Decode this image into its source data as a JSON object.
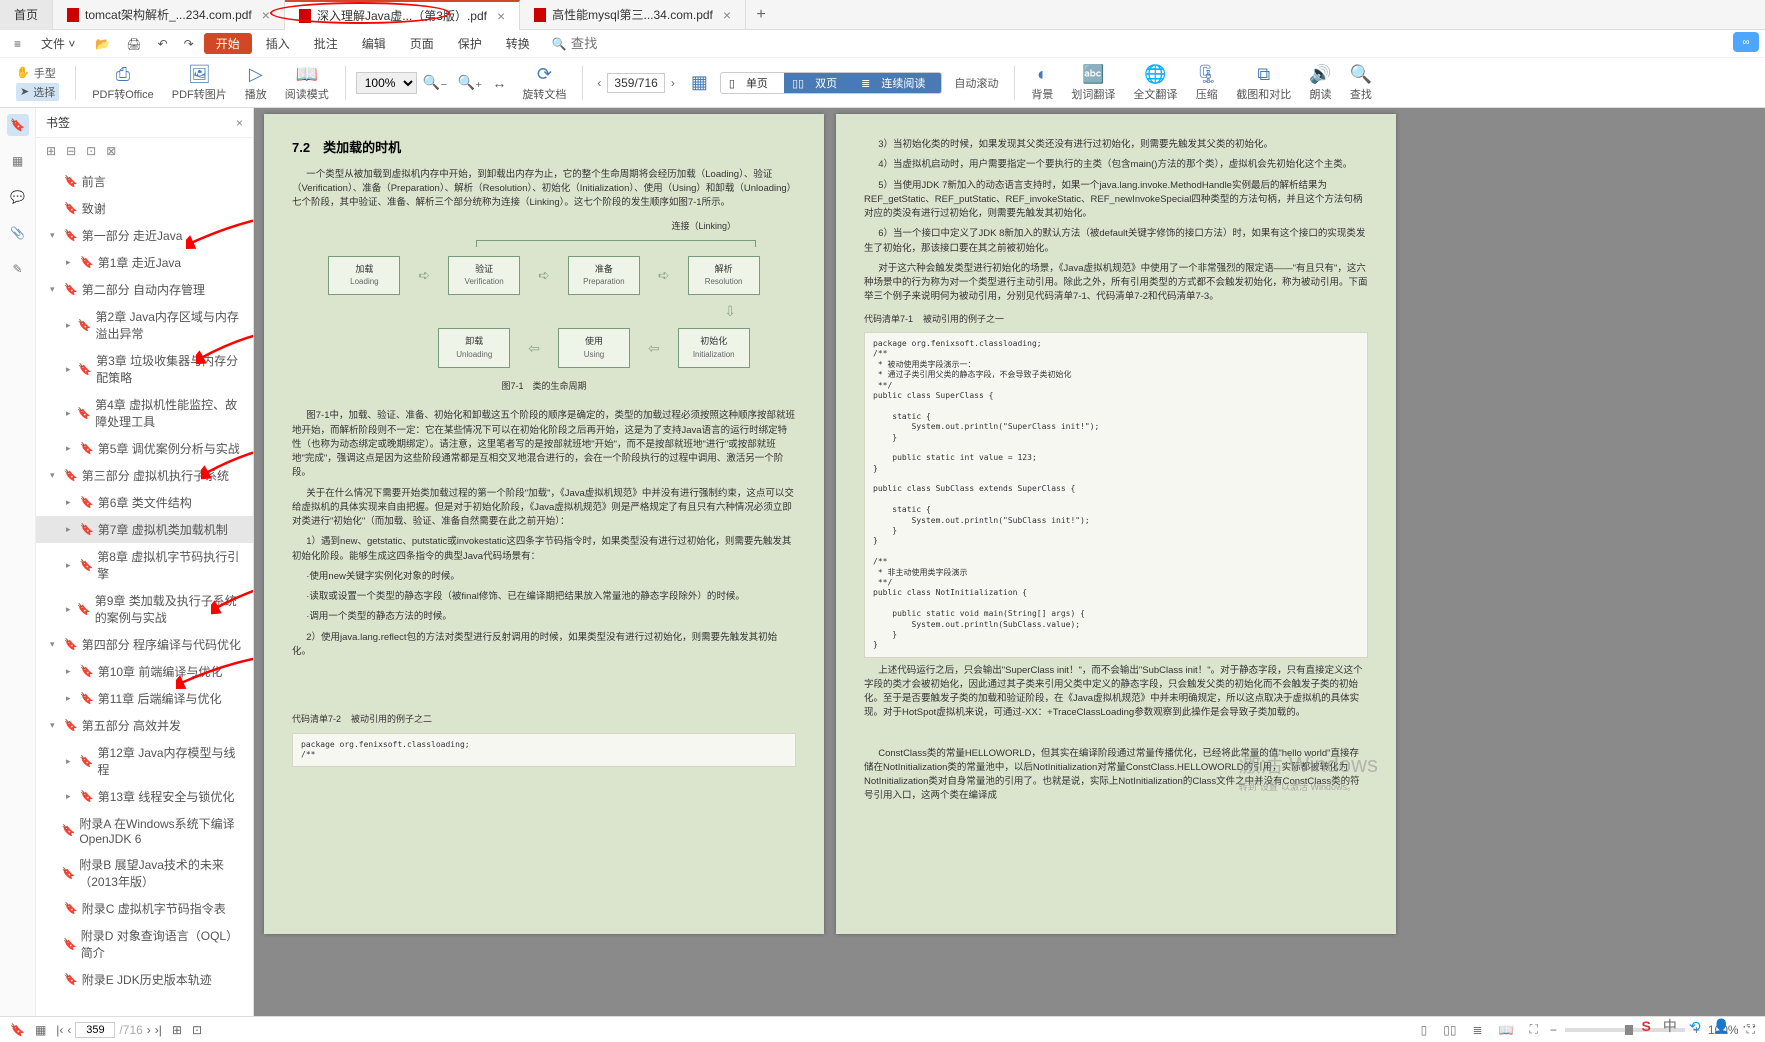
{
  "tabs": {
    "home": "首页",
    "items": [
      {
        "label": "tomcat架构解析_...234.com.pdf"
      },
      {
        "label": "深入理解Java虚...（第3版）.pdf"
      },
      {
        "label": "高性能mysql第三...34.com.pdf"
      }
    ]
  },
  "menubar": {
    "file": "文件",
    "items": [
      "开始",
      "插入",
      "批注",
      "编辑",
      "页面",
      "保护",
      "转换"
    ],
    "search_placeholder": "查找"
  },
  "ribbon": {
    "hand": "手型",
    "select": "选择",
    "pdf2office": "PDF转Office",
    "pdf2pic": "PDF转图片",
    "play": "播放",
    "readmode": "阅读模式",
    "zoom_value": "100%",
    "rotate": "旋转文档",
    "page_cur": "359",
    "page_total": "716",
    "single": "单页",
    "double": "双页",
    "continuous": "连续阅读",
    "autoscroll": "自动滚动",
    "background": "背景",
    "word_translate": "划词翻译",
    "full_translate": "全文翻译",
    "compress": "压缩",
    "crop_compare": "截图和对比",
    "read_aloud": "朗读",
    "find": "查找"
  },
  "bookmarks_title": "书签",
  "bookmarks": [
    {
      "lvl": 1,
      "tw": "",
      "label": "前言"
    },
    {
      "lvl": 1,
      "tw": "",
      "label": "致谢"
    },
    {
      "lvl": 1,
      "tw": "▾",
      "label": "第一部分 走近Java"
    },
    {
      "lvl": 2,
      "tw": "▸",
      "label": "第1章 走近Java"
    },
    {
      "lvl": 1,
      "tw": "▾",
      "label": "第二部分 自动内存管理"
    },
    {
      "lvl": 2,
      "tw": "▸",
      "label": "第2章 Java内存区域与内存溢出异常"
    },
    {
      "lvl": 2,
      "tw": "▸",
      "label": "第3章 垃圾收集器与内存分配策略"
    },
    {
      "lvl": 2,
      "tw": "▸",
      "label": "第4章 虚拟机性能监控、故障处理工具"
    },
    {
      "lvl": 2,
      "tw": "▸",
      "label": "第5章 调优案例分析与实战"
    },
    {
      "lvl": 1,
      "tw": "▾",
      "label": "第三部分 虚拟机执行子系统"
    },
    {
      "lvl": 2,
      "tw": "▸",
      "label": "第6章 类文件结构"
    },
    {
      "lvl": 2,
      "tw": "▸",
      "label": "第7章 虚拟机类加载机制",
      "sel": true
    },
    {
      "lvl": 2,
      "tw": "▸",
      "label": "第8章 虚拟机字节码执行引擎"
    },
    {
      "lvl": 2,
      "tw": "▸",
      "label": "第9章 类加载及执行子系统的案例与实战"
    },
    {
      "lvl": 1,
      "tw": "▾",
      "label": "第四部分 程序编译与代码优化"
    },
    {
      "lvl": 2,
      "tw": "▸",
      "label": "第10章 前端编译与优化"
    },
    {
      "lvl": 2,
      "tw": "▸",
      "label": "第11章 后端编译与优化"
    },
    {
      "lvl": 1,
      "tw": "▾",
      "label": "第五部分 高效并发"
    },
    {
      "lvl": 2,
      "tw": "▸",
      "label": "第12章 Java内存模型与线程"
    },
    {
      "lvl": 2,
      "tw": "▸",
      "label": "第13章 线程安全与锁优化"
    },
    {
      "lvl": 1,
      "tw": "",
      "label": "附录A 在Windows系统下编译OpenJDK 6"
    },
    {
      "lvl": 1,
      "tw": "",
      "label": "附录B 展望Java技术的未来（2013年版）"
    },
    {
      "lvl": 1,
      "tw": "",
      "label": "附录C 虚拟机字节码指令表"
    },
    {
      "lvl": 1,
      "tw": "",
      "label": "附录D 对象查询语言（OQL）简介"
    },
    {
      "lvl": 1,
      "tw": "",
      "label": "附录E JDK历史版本轨迹"
    }
  ],
  "pageL": {
    "h": "7.2　类加载的时机",
    "p1": "一个类型从被加载到虚拟机内存中开始，到卸载出内存为止，它的整个生命周期将会经历加载（Loading）、验证（Verification）、准备（Preparation）、解析（Resolution）、初始化（Initialization）、使用（Using）和卸载（Unloading）七个阶段，其中验证、准备、解析三个部分统称为连接（Linking）。这七个阶段的发生顺序如图7-1所示。",
    "linking": "连接（Linking）",
    "box_load": "加载",
    "box_load_en": "Loading",
    "box_verify": "验证",
    "box_verify_en": "Verification",
    "box_prep": "准备",
    "box_prep_en": "Preparation",
    "box_res": "解析",
    "box_res_en": "Resolution",
    "box_unload": "卸载",
    "box_unload_en": "Unloading",
    "box_use": "使用",
    "box_use_en": "Using",
    "box_init": "初始化",
    "box_init_en": "Initialization",
    "figcap": "图7-1　类的生命周期",
    "p2": "图7-1中，加载、验证、准备、初始化和卸载这五个阶段的顺序是确定的，类型的加载过程必须按照这种顺序按部就班地开始，而解析阶段则不一定：它在某些情况下可以在初始化阶段之后再开始，这是为了支持Java语言的运行时绑定特性（也称为动态绑定或晚期绑定）。请注意，这里笔者写的是按部就班地\"开始\"，而不是按部就班地\"进行\"或按部就班地\"完成\"，强调这点是因为这些阶段通常都是互相交叉地混合进行的，会在一个阶段执行的过程中调用、激活另一个阶段。",
    "p3": "关于在什么情况下需要开始类加载过程的第一个阶段\"加载\"，《Java虚拟机规范》中并没有进行强制约束，这点可以交给虚拟机的具体实现来自由把握。但是对于初始化阶段，《Java虚拟机规范》则是严格规定了有且只有六种情况必须立即对类进行\"初始化\"（而加载、验证、准备自然需要在此之前开始）：",
    "p4": "1）遇到new、getstatic、putstatic或invokestatic这四条字节码指令时，如果类型没有进行过初始化，则需要先触发其初始化阶段。能够生成这四条指令的典型Java代码场景有：",
    "p5": "·使用new关键字实例化对象的时候。",
    "p6": "·读取或设置一个类型的静态字段（被final修饰、已在编译期把结果放入常量池的静态字段除外）的时候。",
    "p7": "·调用一个类型的静态方法的时候。",
    "p8": "2）使用java.lang.reflect包的方法对类型进行反射调用的时候，如果类型没有进行过初始化，则需要先触发其初始化。",
    "codehead2_a": "代码清单7-2",
    "codehead2_b": "被动引用的例子之二",
    "code2": "package org.fenixsoft.classloading;\n/**"
  },
  "pageR": {
    "p3": "3）当初始化类的时候，如果发现其父类还没有进行过初始化，则需要先触发其父类的初始化。",
    "p4": "4）当虚拟机启动时，用户需要指定一个要执行的主类（包含main()方法的那个类），虚拟机会先初始化这个主类。",
    "p5": "5）当使用JDK 7新加入的动态语言支持时，如果一个java.lang.invoke.MethodHandle实例最后的解析结果为REF_getStatic、REF_putStatic、REF_invokeStatic、REF_newInvokeSpecial四种类型的方法句柄，并且这个方法句柄对应的类没有进行过初始化，则需要先触发其初始化。",
    "p6": "6）当一个接口中定义了JDK 8新加入的默认方法（被default关键字修饰的接口方法）时，如果有这个接口的实现类发生了初始化，那该接口要在其之前被初始化。",
    "p7": "对于这六种会触发类型进行初始化的场景，《Java虚拟机规范》中使用了一个非常强烈的限定语——\"有且只有\"，这六种场景中的行为称为对一个类型进行主动引用。除此之外，所有引用类型的方式都不会触发初始化，称为被动引用。下面举三个例子来说明何为被动引用，分别见代码清单7-1、代码清单7-2和代码清单7-3。",
    "codehead1_a": "代码清单7-1",
    "codehead1_b": "被动引用的例子之一",
    "code1": "package org.fenixsoft.classloading;\n/**\n * 被动使用类字段演示一：\n * 通过子类引用父类的静态字段，不会导致子类初始化\n **/\npublic class SuperClass {\n\n    static {\n        System.out.println(\"SuperClass init!\");\n    }\n\n    public static int value = 123;\n}\n\npublic class SubClass extends SuperClass {\n\n    static {\n        System.out.println(\"SubClass init!\");\n    }\n}\n\n/**\n * 非主动使用类字段演示\n **/\npublic class NotInitialization {\n\n    public static void main(String[] args) {\n        System.out.println(SubClass.value);\n    }\n}",
    "p8": "上述代码运行之后，只会输出\"SuperClass init！\"，而不会输出\"SubClass init！\"。对于静态字段，只有直接定义这个字段的类才会被初始化，因此通过其子类来引用父类中定义的静态字段，只会触发父类的初始化而不会触发子类的初始化。至于是否要触发子类的加载和验证阶段，在《Java虚拟机规范》中并未明确规定，所以这点取决于虚拟机的具体实现。对于HotSpot虚拟机来说，可通过-XX：+TraceClassLoading参数观察到此操作是会导致子类加载的。",
    "p9": "ConstClass类的常量HELLOWORLD，但其实在编译阶段通过常量传播优化，已经将此常量的值\"hello world\"直接存储在NotInitialization类的常量池中，以后NotInitialization对常量ConstClass.HELLOWORLD的引用，实际都被转化为NotInitialization类对自身常量池的引用了。也就是说，实际上NotInitialization的Class文件之中并没有ConstClass类的符号引用入口，这两个类在编译成",
    "watermark": "激活 Windows",
    "watermark_sub": "转到\"设置\"以激活 Windows。"
  },
  "status": {
    "page_cur": "359",
    "page_total": "716",
    "zoom": "100%"
  }
}
